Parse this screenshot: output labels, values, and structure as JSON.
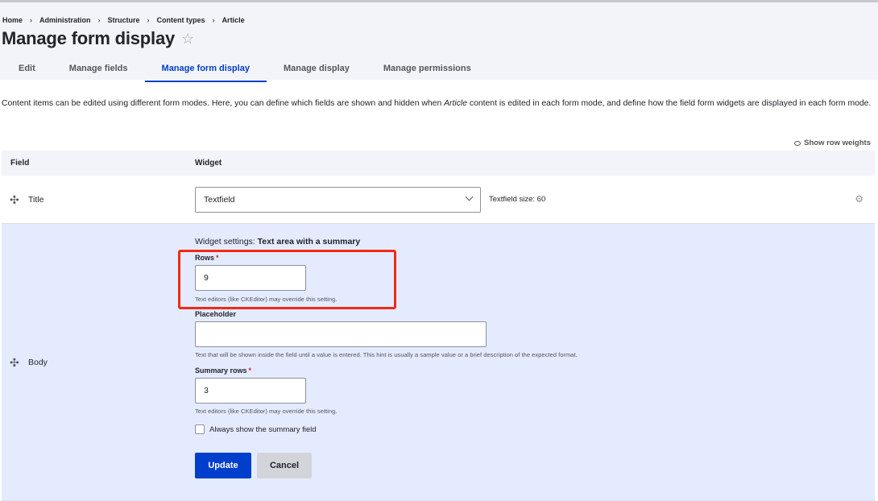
{
  "breadcrumb": [
    {
      "label": "Home"
    },
    {
      "label": "Administration"
    },
    {
      "label": "Structure"
    },
    {
      "label": "Content types"
    },
    {
      "label": "Article"
    }
  ],
  "breadcrumb_separator": "›",
  "page": {
    "title": "Manage form display",
    "favorite_icon": "☆"
  },
  "tabs": [
    {
      "label": "Edit",
      "active": false
    },
    {
      "label": "Manage fields",
      "active": false
    },
    {
      "label": "Manage form display",
      "active": true
    },
    {
      "label": "Manage display",
      "active": false
    },
    {
      "label": "Manage permissions",
      "active": false
    }
  ],
  "description": {
    "before": "Content items can be edited using different form modes. Here, you can define which fields are shown and hidden when ",
    "emphasis": "Article",
    "after": " content is edited in each form mode, and define how the field form widgets are displayed in each form mode."
  },
  "show_row_weights": "Show row weights",
  "table": {
    "headers": {
      "field": "Field",
      "widget": "Widget"
    },
    "rows": [
      {
        "field": "Title",
        "widget": "Textfield",
        "summary": "Textfield size: 60",
        "drag_icon": "✣",
        "settings_icon": "⚙"
      },
      {
        "field": "Body",
        "drag_icon": "✣",
        "widget_settings": {
          "prefix": "Widget settings: ",
          "name": "Text area with a summary",
          "rows": {
            "label": "Rows",
            "required_marker": "*",
            "value": "9",
            "help": "Text editors (like CKEditor) may override this setting."
          },
          "placeholder": {
            "label": "Placeholder",
            "value": "",
            "help": "Text that will be shown inside the field until a value is entered. This hint is usually a sample value or a brief description of the expected format."
          },
          "summary_rows": {
            "label": "Summary rows",
            "required_marker": "*",
            "value": "3",
            "help": "Text editors (like CKEditor) may override this setting."
          },
          "always_show_summary": {
            "label": "Always show the summary field",
            "checked": false
          },
          "update_label": "Update",
          "cancel_label": "Cancel"
        }
      }
    ]
  },
  "colors": {
    "accent": "#003ecc",
    "highlight_box": "#f02a12",
    "expanded_row_bg": "#e4ebff",
    "required": "#dc2323"
  }
}
